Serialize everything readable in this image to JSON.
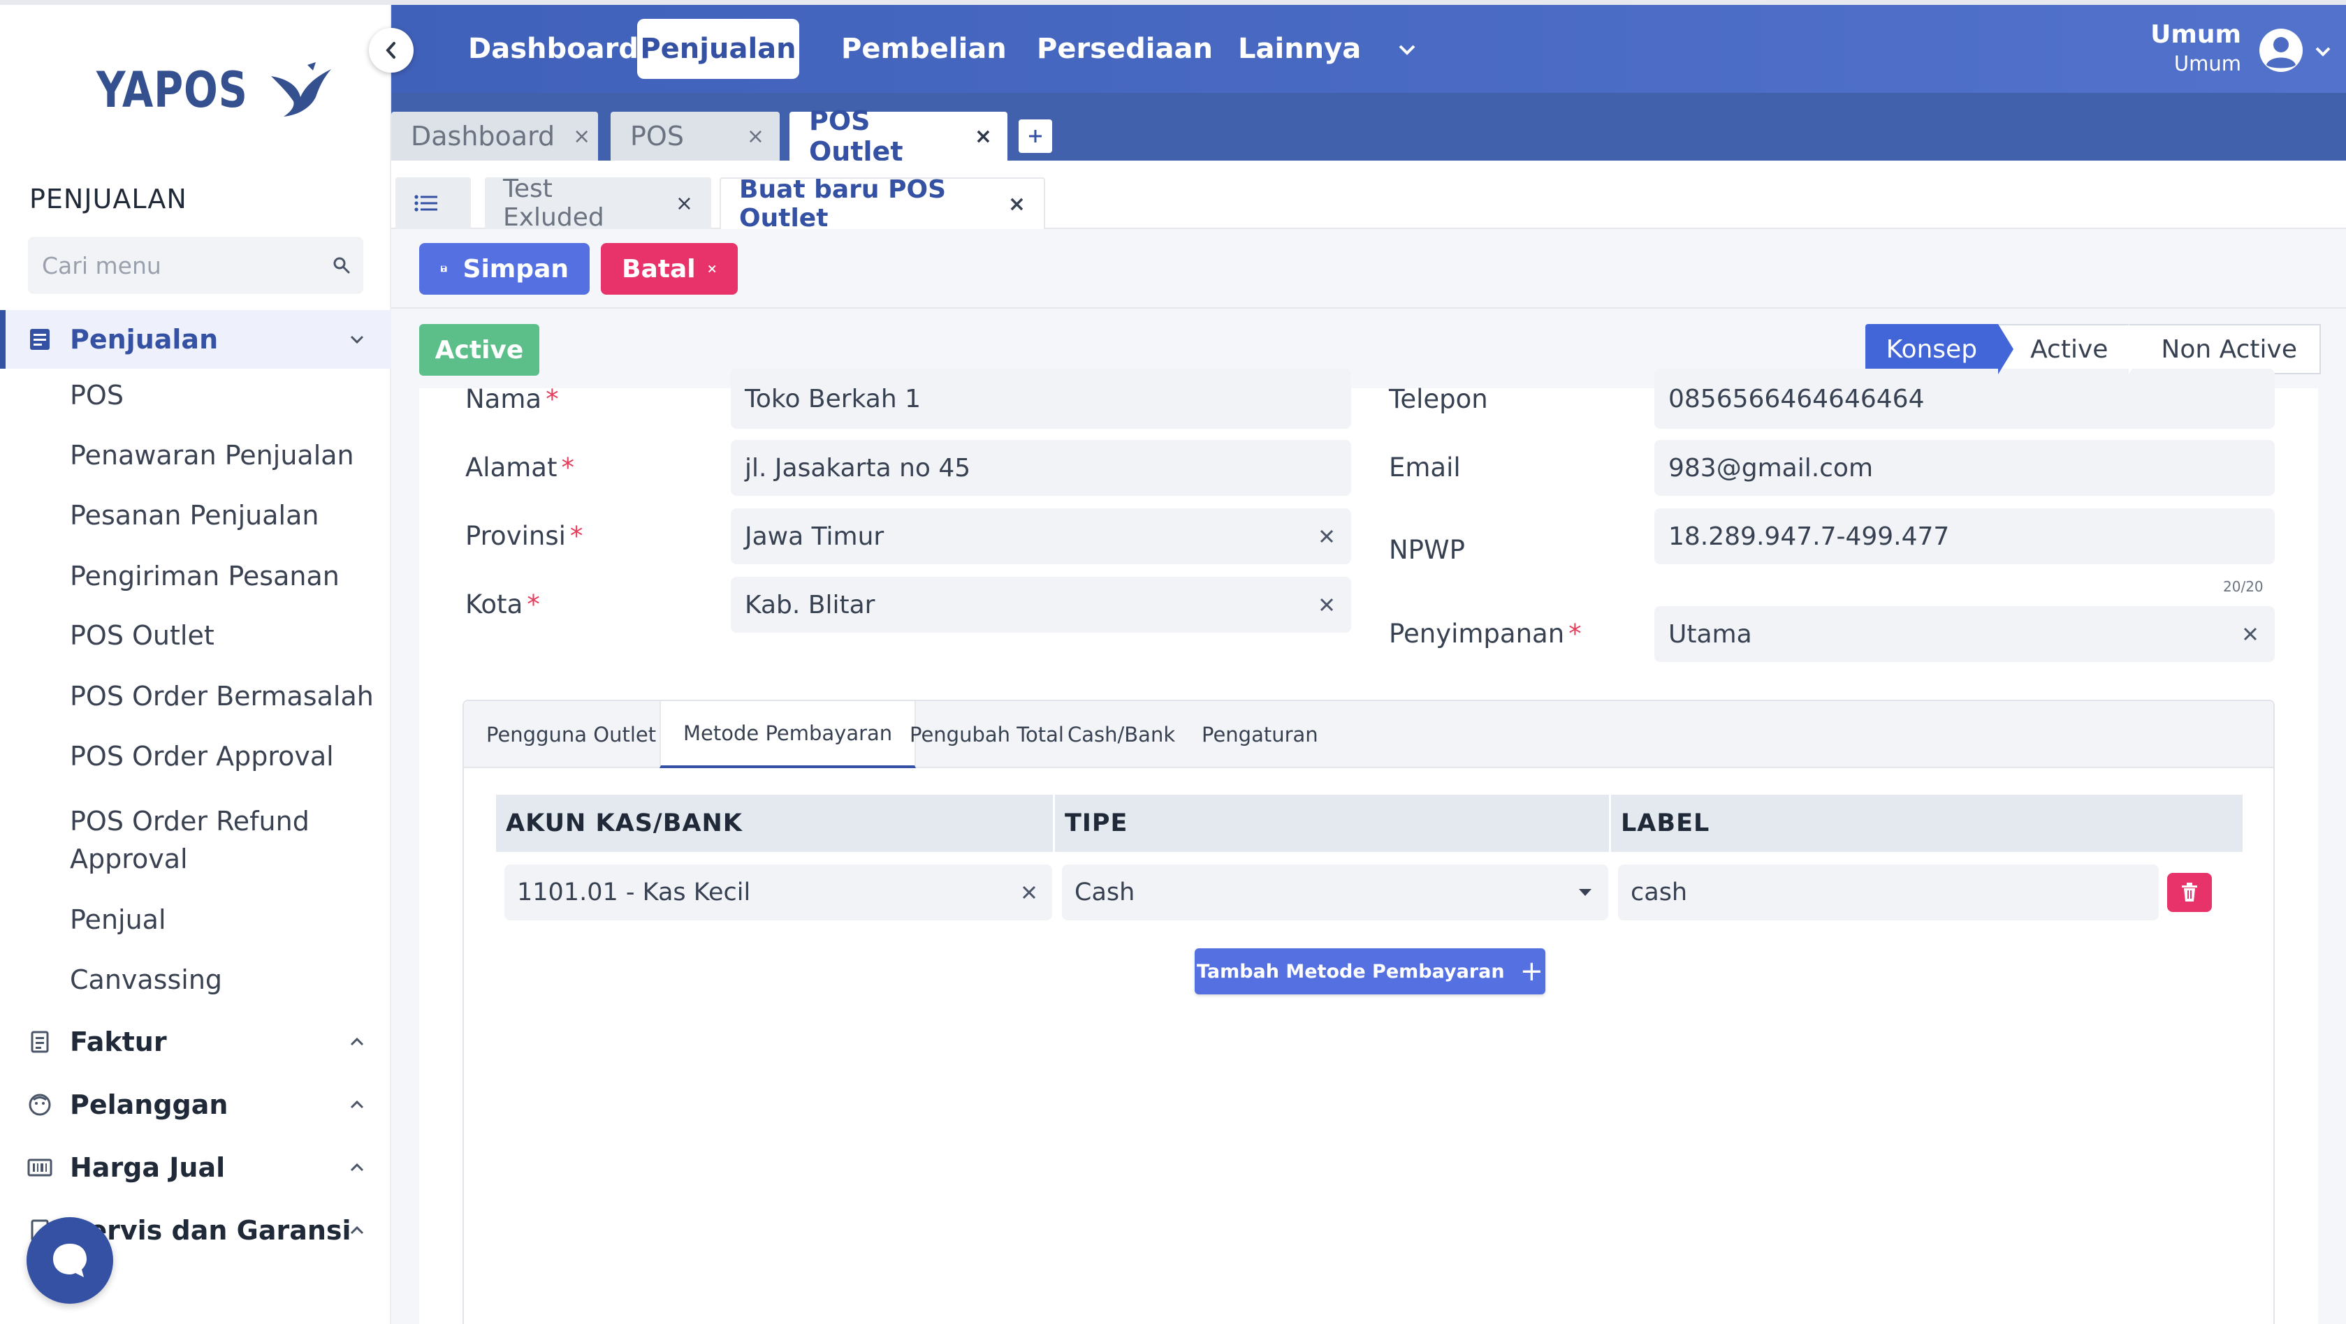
{
  "app": {
    "brand": "YAPOS"
  },
  "colors": {
    "primary": "#3451a3",
    "nav": "#4c6cc4",
    "success": "#5cbf8a",
    "danger": "#e8336a",
    "button": "#5570e0"
  },
  "sidebar": {
    "section_title": "PENJUALAN",
    "search_placeholder": "Cari menu",
    "groups": [
      {
        "label": "Penjualan",
        "icon": "list-document-icon",
        "expanded": true,
        "items": [
          "POS",
          "Penawaran Penjualan",
          "Pesanan Penjualan",
          "Pengiriman Pesanan",
          "POS Outlet",
          "POS Order Bermasalah",
          "POS Order Approval",
          "POS Order Refund Approval",
          "Penjual",
          "Canvassing"
        ]
      },
      {
        "label": "Faktur",
        "icon": "invoice-icon"
      },
      {
        "label": "Pelanggan",
        "icon": "customer-face-icon"
      },
      {
        "label": "Harga Jual",
        "icon": "barcode-icon"
      },
      {
        "label": "Servis dan Garansi",
        "icon": "service-icon"
      }
    ]
  },
  "topnav": {
    "items": [
      {
        "label": "Dashboard",
        "active": false
      },
      {
        "label": "Penjualan",
        "active": true
      },
      {
        "label": "Pembelian",
        "active": false
      },
      {
        "label": "Persediaan",
        "active": false
      },
      {
        "label": "Lainnya",
        "active": false
      }
    ],
    "user": {
      "name": "Umum",
      "role": "Umum"
    }
  },
  "tabs": [
    {
      "label": "Dashboard",
      "close": "×"
    },
    {
      "label": "POS",
      "close": "×"
    },
    {
      "label": "POS Outlet",
      "close": "×",
      "active": true
    }
  ],
  "subtabs": [
    {
      "label": "Test Exluded",
      "close": "×"
    },
    {
      "label": "Buat baru POS Outlet",
      "close": "×",
      "active": true
    }
  ],
  "actions": {
    "save": "Simpan",
    "cancel": "Batal"
  },
  "status": {
    "badge": "Active",
    "steps": [
      "Konsep",
      "Active",
      "Non Active"
    ],
    "current": "Konsep"
  },
  "form": {
    "nama": {
      "label": "Nama",
      "value": "Toko Berkah 1"
    },
    "alamat": {
      "label": "Alamat",
      "value": "jl. Jasakarta no 45"
    },
    "provinsi": {
      "label": "Provinsi",
      "value": "Jawa Timur"
    },
    "kota": {
      "label": "Kota",
      "value": "Kab. Blitar"
    },
    "telepon": {
      "label": "Telepon",
      "value": "0856566464646464"
    },
    "email": {
      "label": "Email",
      "value": "983@gmail.com"
    },
    "npwp": {
      "label": "NPWP",
      "value": "18.289.947.7-499.477",
      "counter": "20/20"
    },
    "penyimpanan": {
      "label": "Penyimpanan",
      "value": "Utama"
    }
  },
  "panel": {
    "tabs": [
      "Pengguna Outlet",
      "Metode Pembayaran",
      "Pengubah Total",
      "Cash/Bank",
      "Pengaturan"
    ],
    "active_tab": "Metode Pembayaran",
    "columns": [
      "AKUN KAS/BANK",
      "TIPE",
      "LABEL"
    ],
    "rows": [
      {
        "akun": "1101.01 - Kas Kecil",
        "tipe": "Cash",
        "label": "cash"
      }
    ],
    "add_button": "Tambah Metode Pembayaran",
    "add_plus": "+"
  }
}
